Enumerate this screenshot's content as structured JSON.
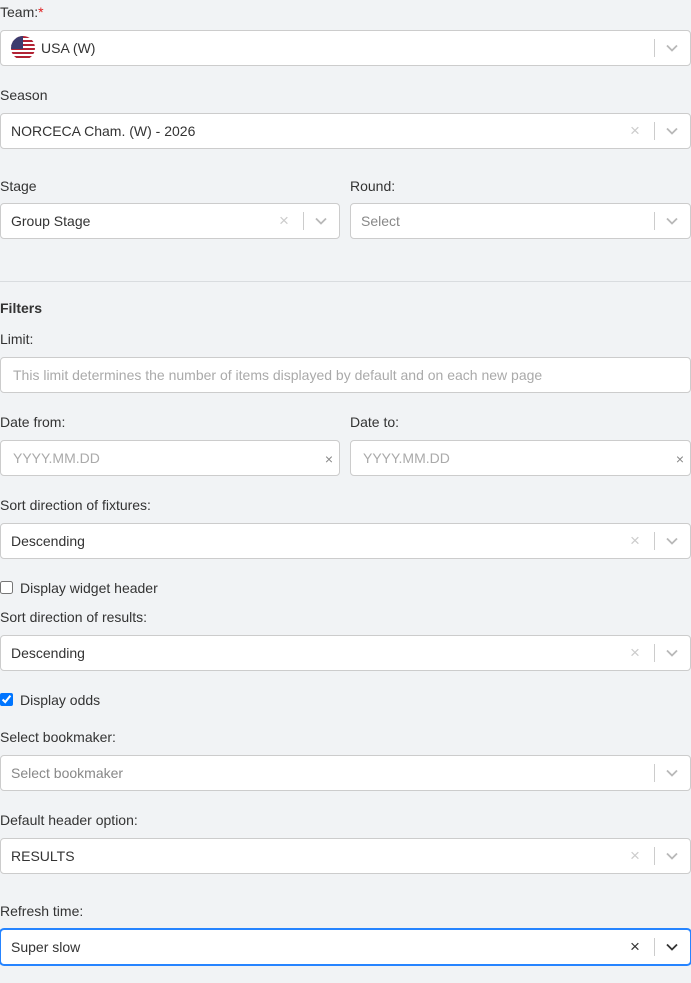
{
  "team": {
    "label": "Team:",
    "required_mark": "*",
    "value": "USA (W)",
    "flag_icon": "usa-flag-icon"
  },
  "season": {
    "label": "Season",
    "value": "NORCECA Cham. (W) - 2026"
  },
  "stage": {
    "label": "Stage",
    "value": "Group Stage"
  },
  "round": {
    "label": "Round:",
    "placeholder": "Select"
  },
  "filters": {
    "heading": "Filters"
  },
  "limit": {
    "label": "Limit:",
    "placeholder": "This limit determines the number of items displayed by default and on each new page"
  },
  "date_from": {
    "label": "Date from:",
    "placeholder": "YYYY.MM.DD",
    "clear": "×"
  },
  "date_to": {
    "label": "Date to:",
    "placeholder": "YYYY.MM.DD",
    "clear": "×"
  },
  "sort_fixtures": {
    "label": "Sort direction of fixtures:",
    "value": "Descending"
  },
  "display_header": {
    "label": "Display widget header",
    "checked": false
  },
  "sort_results": {
    "label": "Sort direction of results:",
    "value": "Descending"
  },
  "display_odds": {
    "label": "Display odds",
    "checked": true
  },
  "bookmaker": {
    "label": "Select bookmaker:",
    "placeholder": "Select bookmaker"
  },
  "header_option": {
    "label": "Default header option:",
    "value": "RESULTS"
  },
  "refresh": {
    "label": "Refresh time:",
    "value": "Super slow"
  },
  "icons": {
    "clear": "×",
    "chevron": "chevron-down-icon"
  }
}
